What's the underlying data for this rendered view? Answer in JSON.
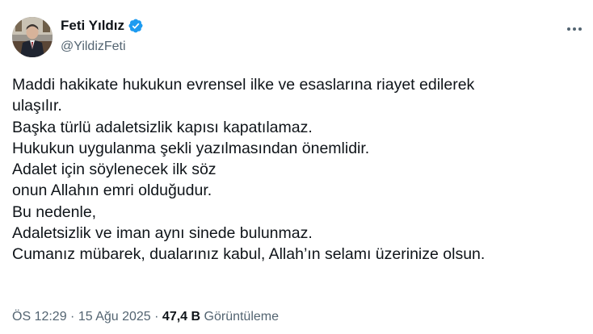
{
  "user": {
    "name": "Feti Yıldız",
    "handle": "@YildizFeti",
    "verified_color": "#1d9bf0"
  },
  "tweet": {
    "lines": [
      "Maddi hakikate hukukun evrensel ilke ve esaslarına riayet edilerek",
      "ulaşılır.",
      "Başka türlü adaletsizlik kapısı kapatılamaz.",
      "Hukukun uygulanma şekli yazılmasından önemlidir.",
      "Adalet için söylenecek ilk söz",
      "onun Allahın emri olduğudur.",
      "Bu nedenle,",
      "Adaletsizlik ve iman aynı sinede bulunmaz.",
      "Cumanız mübarek, dualarınız kabul, Allah’ın selamı üzerinize olsun."
    ]
  },
  "meta": {
    "time": "ÖS 12:29",
    "separator": " · ",
    "date": "15 Ağu 2025",
    "views_count": "47,4 B",
    "views_label": "Görüntüleme"
  },
  "icons": {
    "more": "more-options-icon",
    "verified": "verified-badge-icon"
  }
}
